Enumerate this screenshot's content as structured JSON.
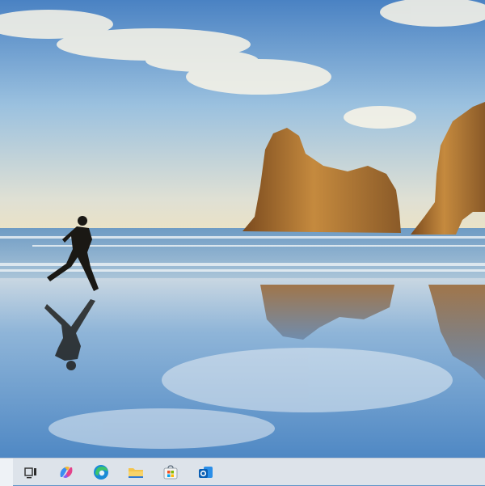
{
  "desktop": {
    "wallpaper": "beach-runner-sea-arch-wallpaper"
  },
  "taskbar": {
    "background": "#dde3ea",
    "items": [
      {
        "name": "start-button",
        "icon": "start-icon"
      },
      {
        "name": "task-view-button",
        "icon": "task-view-icon"
      },
      {
        "name": "copilot-button",
        "icon": "copilot-icon"
      },
      {
        "name": "edge-button",
        "icon": "edge-icon"
      },
      {
        "name": "file-explorer-button",
        "icon": "folder-icon"
      },
      {
        "name": "microsoft-store-button",
        "icon": "store-icon"
      },
      {
        "name": "outlook-button",
        "icon": "outlook-icon"
      }
    ]
  },
  "colors": {
    "sky_top": "#4d86c6",
    "sky_bottom": "#e9e2c8",
    "sea": "#5d8db8",
    "rock": "#a06a2e",
    "sand_reflection": "#6c9fcf"
  }
}
